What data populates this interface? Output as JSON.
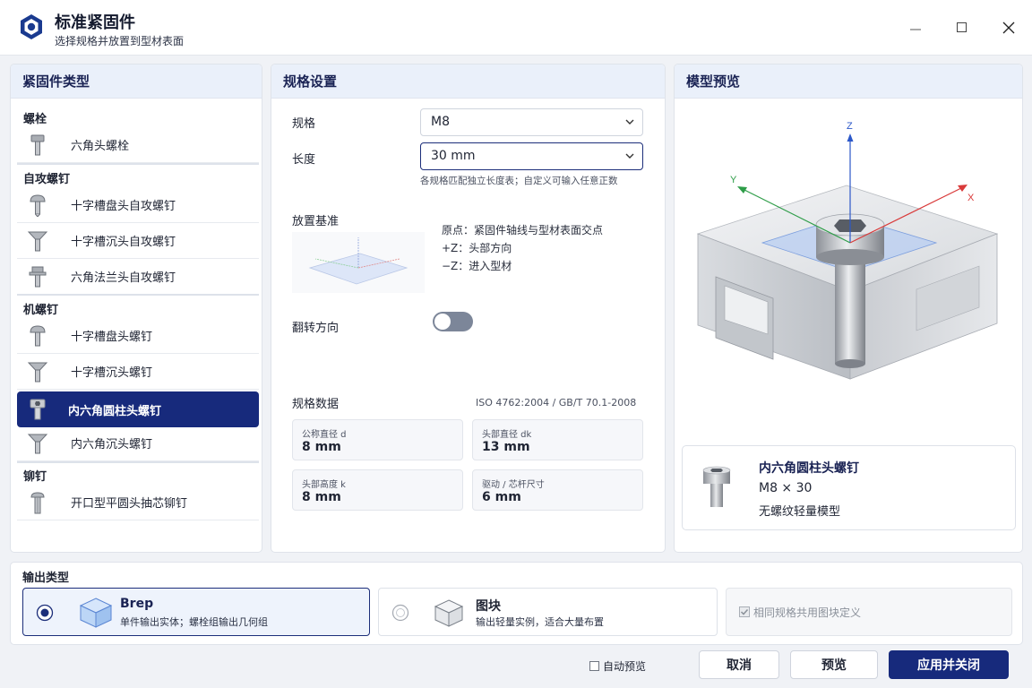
{
  "window": {
    "title": "标准紧固件",
    "subtitle": "选择规格并放置到型材表面",
    "accent": "#172a7c"
  },
  "fastener_types": {
    "header": "紧固件类型",
    "groups": [
      {
        "label": "螺栓",
        "items": [
          {
            "label": "六角头螺栓",
            "icon": "hex-bolt-icon"
          }
        ]
      },
      {
        "label": "自攻螺钉",
        "items": [
          {
            "label": "十字槽盘头自攻螺钉",
            "icon": "pan-head-screw-icon"
          },
          {
            "label": "十字槽沉头自攻螺钉",
            "icon": "countersunk-screw-icon"
          },
          {
            "label": "六角法兰头自攻螺钉",
            "icon": "hex-flange-screw-icon"
          }
        ]
      },
      {
        "label": "机螺钉",
        "items": [
          {
            "label": "十字槽盘头螺钉",
            "icon": "pan-head-screw-icon"
          },
          {
            "label": "十字槽沉头螺钉",
            "icon": "countersunk-screw-icon"
          },
          {
            "label": "内六角圆柱头螺钉",
            "icon": "socket-cap-screw-icon",
            "selected": true
          },
          {
            "label": "内六角沉头螺钉",
            "icon": "countersunk-screw-icon"
          }
        ]
      },
      {
        "label": "铆钉",
        "items": [
          {
            "label": "开口型平圆头抽芯铆钉",
            "icon": "blind-rivet-icon"
          }
        ]
      }
    ]
  },
  "spec_settings": {
    "header": "规格设置",
    "size_label": "规格",
    "size_value": "M8",
    "length_label": "长度",
    "length_value": "30 mm",
    "length_hint": "各规格匹配独立长度表；自定义可输入任意正数",
    "placement_label": "放置基准",
    "placement_lines": [
      "原点：紧固件轴线与型材表面交点",
      "+Z：头部方向",
      "−Z：进入型材"
    ],
    "flip_label": "翻转方向",
    "flip_on": false,
    "spec_data_label": "规格数据",
    "standard": "ISO 4762:2004 / GB/T 70.1-2008",
    "specs": [
      {
        "key": "公称直径 d",
        "value": "8 mm"
      },
      {
        "key": "头部直径 dk",
        "value": "13 mm"
      },
      {
        "key": "头部高度 k",
        "value": "8 mm"
      },
      {
        "key": "驱动 / 芯杆尺寸",
        "value": "6 mm"
      }
    ]
  },
  "preview": {
    "header": "模型预览",
    "axes": {
      "x": "X",
      "y": "Y",
      "z": "Z"
    },
    "card_title": "内六角圆柱头螺钉",
    "card_size": "M8 × 30",
    "card_note": "无螺纹轻量模型"
  },
  "output": {
    "label": "输出类型",
    "options": [
      {
        "title": "Brep",
        "desc": "单件输出实体；螺栓组输出几何组",
        "selected": true,
        "icon": "cube-solid-icon"
      },
      {
        "title": "图块",
        "desc": "输出轻量实例，适合大量布置",
        "selected": false,
        "icon": "cube-outline-icon"
      }
    ],
    "share_block_label": "相同规格共用图块定义",
    "share_block_checked": true,
    "share_block_enabled": false
  },
  "footer": {
    "auto_preview_label": "自动预览",
    "auto_preview_checked": false,
    "cancel": "取消",
    "preview": "预览",
    "apply": "应用并关闭"
  }
}
